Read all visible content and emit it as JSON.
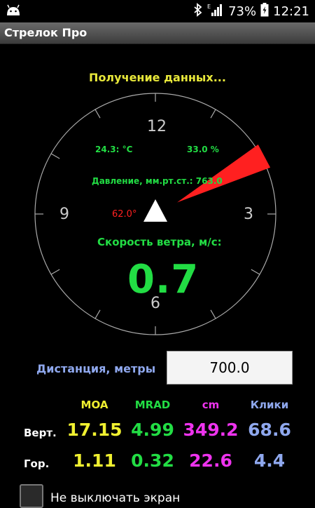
{
  "status_bar": {
    "battery": "73%",
    "time": "12:21",
    "icons": [
      "android-icon",
      "bluetooth-icon",
      "signal-icon",
      "battery-icon"
    ]
  },
  "app": {
    "title": "Стрелок Про"
  },
  "dial": {
    "status": "Получение данных...",
    "clock": {
      "n12": "12",
      "n3": "3",
      "n6": "6",
      "n9": "9"
    },
    "temperature": "24.3: °C",
    "humidity": "33.0 %",
    "pressure": "Давление, мм.рт.ст.: 763.0",
    "angle": "62.0°",
    "wind_label": "Скорость ветра, м/с:",
    "wind_value": "0.7",
    "wind_direction_deg": 62
  },
  "distance": {
    "label": "Дистанция, метры",
    "value": "700.0"
  },
  "table": {
    "headers": [
      "MOA",
      "MRAD",
      "cm",
      "Клики"
    ],
    "header_colors": [
      "#f0f030",
      "#22dd44",
      "#ee33ee",
      "#8fa8ee"
    ],
    "rows": [
      {
        "label": "Верт.",
        "values": [
          "17.15",
          "4.99",
          "349.2",
          "68.6"
        ]
      },
      {
        "label": "Гор.",
        "values": [
          "1.11",
          "0.32",
          "22.6",
          "4.4"
        ]
      }
    ]
  },
  "keep_screen": {
    "label": "Не выключать экран",
    "checked": false
  },
  "colors": {
    "green": "#22dd44",
    "red": "#ff2020",
    "yellow": "#e8e83a",
    "blue": "#8fa8ee",
    "magenta": "#ee33ee"
  }
}
